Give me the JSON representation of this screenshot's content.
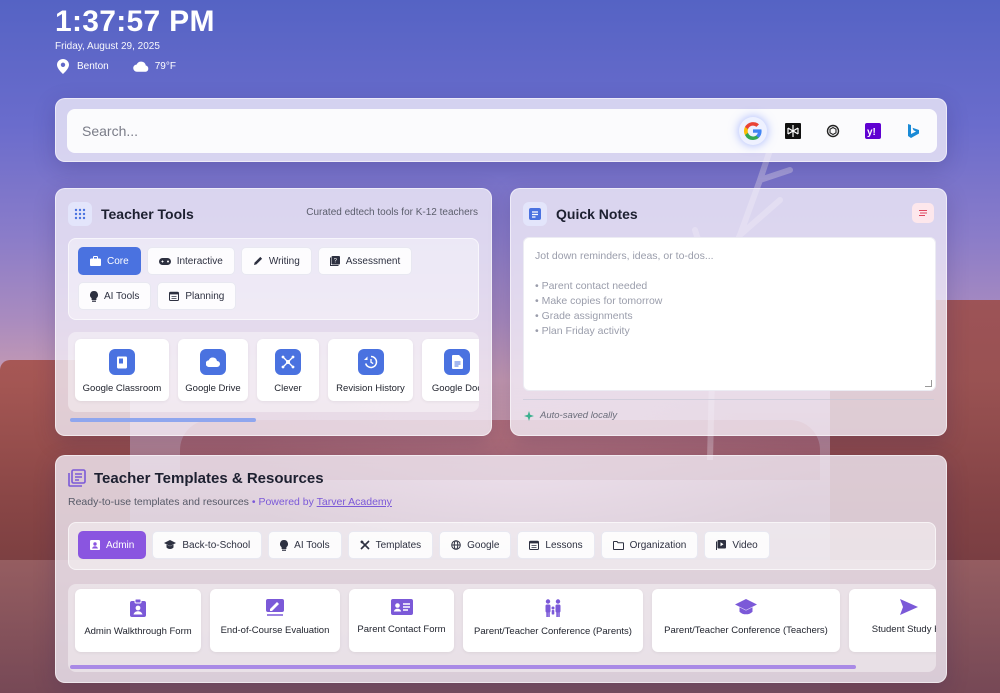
{
  "clock": {
    "time": "1:37:57 PM",
    "date": "Friday, August 29, 2025",
    "location": "Benton",
    "temperature": "79°F"
  },
  "search": {
    "placeholder": "Search...",
    "engines": [
      "google-icon",
      "perplexity-icon",
      "chatgpt-icon",
      "yahoo-icon",
      "bing-icon"
    ]
  },
  "tools": {
    "title": "Teacher Tools",
    "subtitle": "Curated edtech tools for K-12 teachers",
    "tabs": [
      {
        "label": "Core",
        "icon": "briefcase-icon"
      },
      {
        "label": "Interactive",
        "icon": "gamepad-icon"
      },
      {
        "label": "Writing",
        "icon": "pencil-icon"
      },
      {
        "label": "Assessment",
        "icon": "quiz-icon"
      },
      {
        "label": "AI Tools",
        "icon": "lightbulb-icon"
      },
      {
        "label": "Planning",
        "icon": "calendar-icon"
      }
    ],
    "items": [
      {
        "label": "Google Classroom",
        "icon": "classroom-icon"
      },
      {
        "label": "Google Drive",
        "icon": "cloud-icon"
      },
      {
        "label": "Clever",
        "icon": "network-icon"
      },
      {
        "label": "Revision History",
        "icon": "history-icon"
      },
      {
        "label": "Google Doc",
        "icon": "document-icon"
      }
    ]
  },
  "notes": {
    "title": "Quick Notes",
    "placeholder_lines": [
      "Jot down reminders, ideas, or to-dos...",
      "",
      "• Parent contact needed",
      "• Make copies for tomorrow",
      "• Grade assignments",
      "• Plan Friday activity"
    ],
    "autosave": "Auto-saved locally"
  },
  "templates": {
    "title": "Teacher Templates & Resources",
    "subtitle": "Ready-to-use templates and resources",
    "powered_prefix": "• Powered by",
    "powered_link": "Tarver Academy",
    "tabs": [
      {
        "label": "Admin",
        "icon": "badge-icon"
      },
      {
        "label": "Back-to-School",
        "icon": "graduation-cap-icon"
      },
      {
        "label": "AI Tools",
        "icon": "lightbulb-icon"
      },
      {
        "label": "Templates",
        "icon": "tools-icon"
      },
      {
        "label": "Google",
        "icon": "globe-icon"
      },
      {
        "label": "Lessons",
        "icon": "calendar-icon"
      },
      {
        "label": "Organization",
        "icon": "folder-icon"
      },
      {
        "label": "Video",
        "icon": "video-icon"
      }
    ],
    "items": [
      {
        "label": "Admin Walkthrough Form",
        "icon": "clipboard-user-icon"
      },
      {
        "label": "End-of-Course Evaluation",
        "icon": "signature-icon"
      },
      {
        "label": "Parent Contact Form",
        "icon": "id-card-icon"
      },
      {
        "label": "Parent/Teacher Conference (Parents)",
        "icon": "family-icon"
      },
      {
        "label": "Parent/Teacher Conference (Teachers)",
        "icon": "graduation-cap-icon"
      },
      {
        "label": "Student Study Ha",
        "icon": "send-icon"
      }
    ]
  },
  "colors": {
    "core_accent": "#4a72e0",
    "template_accent": "#8a55e0"
  }
}
